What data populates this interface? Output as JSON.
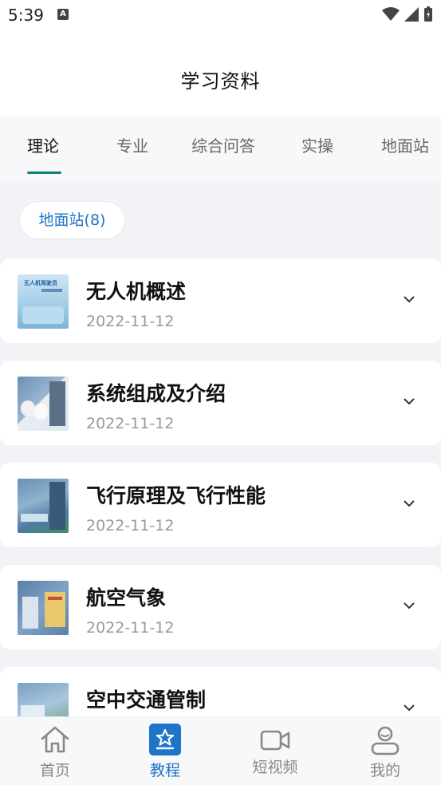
{
  "status_bar": {
    "time": "5:39",
    "notification_glyph": "A"
  },
  "header": {
    "title": "学习资料"
  },
  "tabs": [
    {
      "label": "理论",
      "active": true
    },
    {
      "label": "专业",
      "active": false
    },
    {
      "label": "综合问答",
      "active": false
    },
    {
      "label": "实操",
      "active": false
    },
    {
      "label": "地面站",
      "active": false
    }
  ],
  "filter_chip": {
    "label": "地面站(8)"
  },
  "cards": [
    {
      "title": "无人机概述",
      "date": "2022-11-12",
      "thumb_text": "无人机驾驶员"
    },
    {
      "title": "系统组成及介绍",
      "date": "2022-11-12"
    },
    {
      "title": "飞行原理及飞行性能",
      "date": "2022-11-12"
    },
    {
      "title": "航空气象",
      "date": "2022-11-12"
    },
    {
      "title": "空中交通管制",
      "date": ""
    }
  ],
  "bottom_nav": [
    {
      "label": "首页",
      "icon": "home-icon",
      "active": false
    },
    {
      "label": "教程",
      "icon": "star-book-icon",
      "active": true
    },
    {
      "label": "短视频",
      "icon": "video-camera-icon",
      "active": false
    },
    {
      "label": "我的",
      "icon": "user-icon",
      "active": false
    }
  ],
  "colors": {
    "accent_green": "#11806f",
    "accent_blue": "#1e74c8",
    "background": "#f1f3f6"
  }
}
